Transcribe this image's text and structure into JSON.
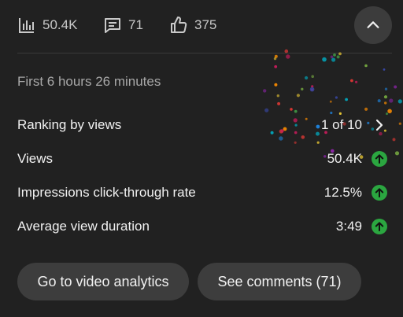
{
  "stats": {
    "views": "50.4K",
    "comments": "71",
    "likes": "375"
  },
  "period_label": "First 6 hours 26 minutes",
  "metrics": [
    {
      "label": "Ranking by views",
      "value": "1 of 10",
      "icon": "chevron-right-icon"
    },
    {
      "label": "Views",
      "value": "50.4K",
      "icon": "trend-up-icon"
    },
    {
      "label": "Impressions click-through rate",
      "value": "12.5%",
      "icon": "trend-up-icon"
    },
    {
      "label": "Average view duration",
      "value": "3:49",
      "icon": "trend-up-icon"
    }
  ],
  "actions": {
    "analytics_label": "Go to video analytics",
    "comments_label": "See comments (71)"
  },
  "colors": {
    "background": "#212121",
    "pill": "#3d3d3d",
    "trend_up": "#2ba640"
  }
}
